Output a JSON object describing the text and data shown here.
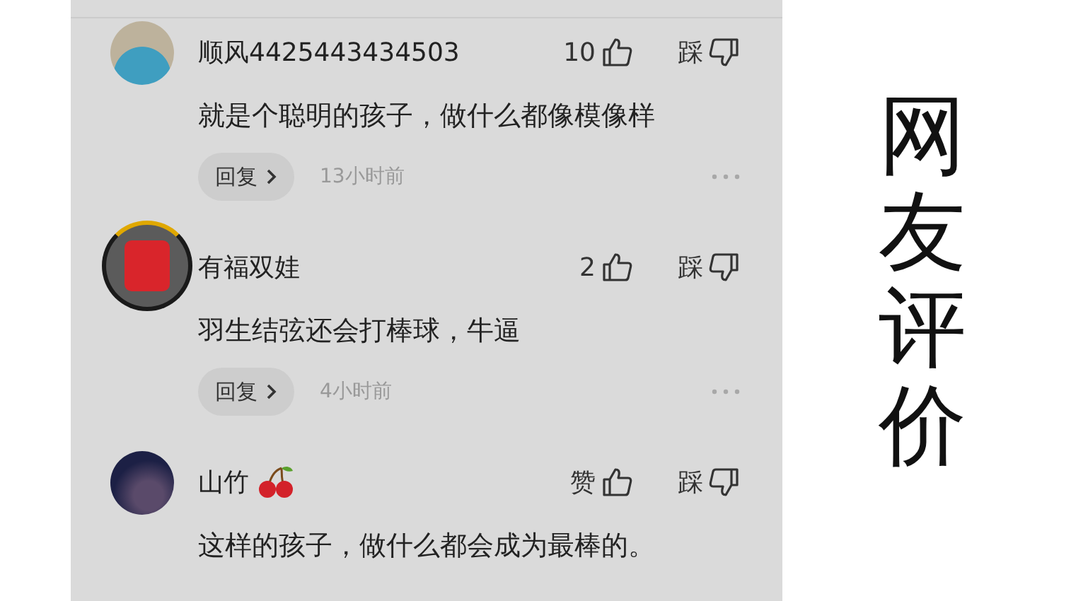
{
  "comments": [
    {
      "avatar": {
        "kind": "cartoon"
      },
      "name": "顺风4425443434503",
      "likes": "10",
      "dislike": "踩",
      "text": "就是个聪明的孩子，做什么都像模像样",
      "reply": "回复",
      "time": "13小时前"
    },
    {
      "avatar": {
        "kind": "red-envelope"
      },
      "name": "有福双娃",
      "likes": "2",
      "dislike": "踩",
      "text": "羽生结弦还会打棒球，牛逼",
      "reply": "回复",
      "time": "4小时前"
    },
    {
      "avatar": {
        "kind": "photo"
      },
      "name": "山竹",
      "badge": {
        "kind": "cherry"
      },
      "likes": "赞",
      "dislike": "踩",
      "text": "这样的孩子，做什么都会成为最棒的。"
    }
  ],
  "caption": "网友评价"
}
